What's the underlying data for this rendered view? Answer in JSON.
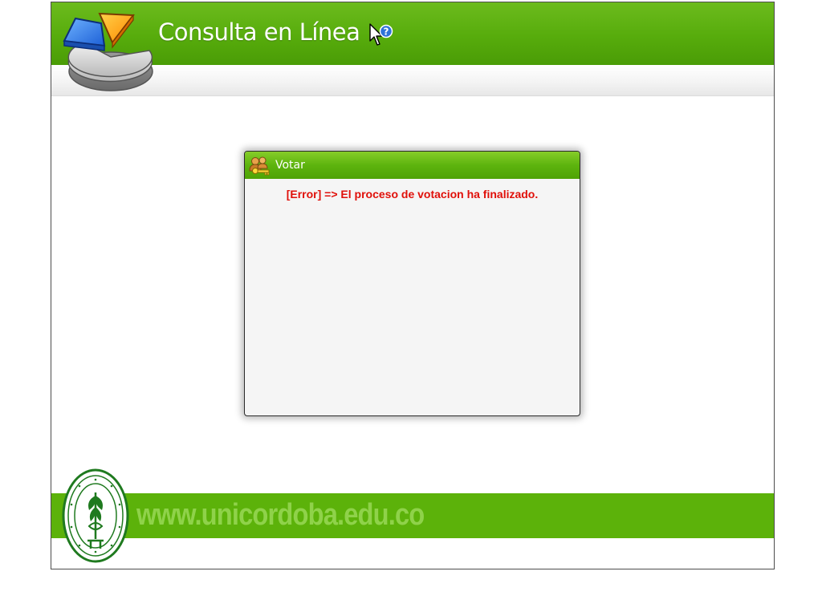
{
  "header": {
    "title": "Consulta en Línea",
    "logo_icon": "pie-chart-icon",
    "help_icon": "help-cursor-icon"
  },
  "dialog": {
    "title": "Votar",
    "icon": "users-key-icon",
    "message": "[Error] => El proceso de votacion ha finalizado."
  },
  "footer": {
    "url_text": "www.unicordoba.edu.co",
    "seal_icon": "university-seal-icon"
  },
  "colors": {
    "header_green": "#57ac0c",
    "footer_green": "#5cb20a",
    "footer_text": "#8fd24a",
    "error_red": "#e0100a",
    "dialog_bg": "#f5f5f5"
  }
}
